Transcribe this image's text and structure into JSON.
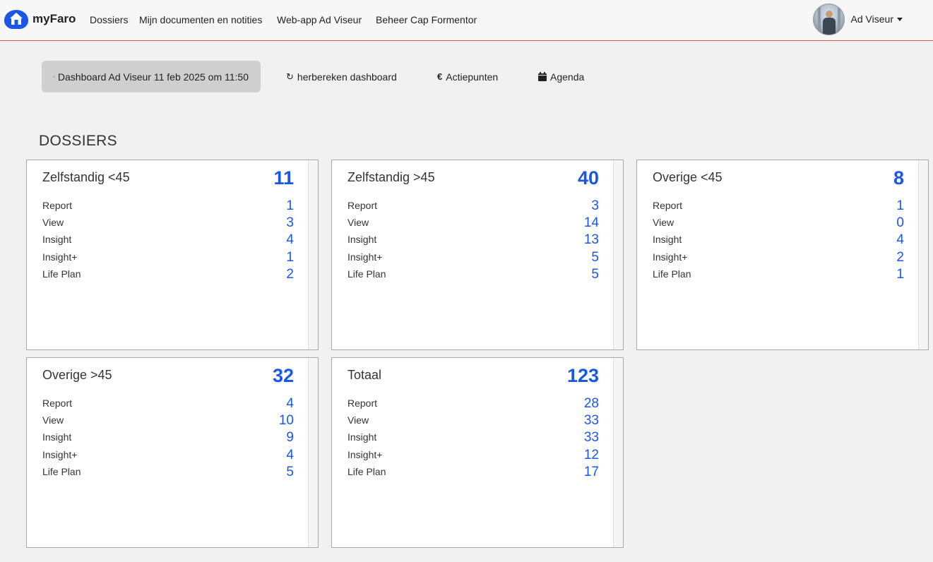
{
  "brand": {
    "name": "myFaro"
  },
  "nav": {
    "items": [
      {
        "label": "Dossiers"
      },
      {
        "label": "Mijn documenten en notities"
      },
      {
        "label": "Web-app Ad Viseur"
      },
      {
        "label": "Beheer Cap Formentor"
      }
    ],
    "user": {
      "name": "Ad Viseur"
    }
  },
  "toolbar": {
    "dashboard": "Dashboard Ad Viseur 11 feb 2025 om 11:50",
    "recalc": "herbereken dashboard",
    "actions": "Actiepunten",
    "agenda": "Agenda"
  },
  "section": {
    "title": "DOSSIERS"
  },
  "accent_color": "#1a56e8",
  "cards": [
    {
      "title": "Zelfstandig <45",
      "total": "11",
      "rows": [
        {
          "label": "Report",
          "value": "1"
        },
        {
          "label": "View",
          "value": "3"
        },
        {
          "label": "Insight",
          "value": "4"
        },
        {
          "label": "Insight+",
          "value": "1"
        },
        {
          "label": "Life Plan",
          "value": "2"
        }
      ]
    },
    {
      "title": "Zelfstandig >45",
      "total": "40",
      "rows": [
        {
          "label": "Report",
          "value": "3"
        },
        {
          "label": "View",
          "value": "14"
        },
        {
          "label": "Insight",
          "value": "13"
        },
        {
          "label": "Insight+",
          "value": "5"
        },
        {
          "label": "Life Plan",
          "value": "5"
        }
      ]
    },
    {
      "title": "Overige <45",
      "total": "8",
      "rows": [
        {
          "label": "Report",
          "value": "1"
        },
        {
          "label": "View",
          "value": "0"
        },
        {
          "label": "Insight",
          "value": "4"
        },
        {
          "label": "Insight+",
          "value": "2"
        },
        {
          "label": "Life Plan",
          "value": "1"
        }
      ]
    },
    {
      "title": "Overige >45",
      "total": "32",
      "rows": [
        {
          "label": "Report",
          "value": "4"
        },
        {
          "label": "View",
          "value": "10"
        },
        {
          "label": "Insight",
          "value": "9"
        },
        {
          "label": "Insight+",
          "value": "4"
        },
        {
          "label": "Life Plan",
          "value": "5"
        }
      ]
    },
    {
      "title": "Totaal",
      "total": "123",
      "rows": [
        {
          "label": "Report",
          "value": "28"
        },
        {
          "label": "View",
          "value": "33"
        },
        {
          "label": "Insight",
          "value": "33"
        },
        {
          "label": "Insight+",
          "value": "12"
        },
        {
          "label": "Life Plan",
          "value": "17"
        }
      ]
    }
  ]
}
